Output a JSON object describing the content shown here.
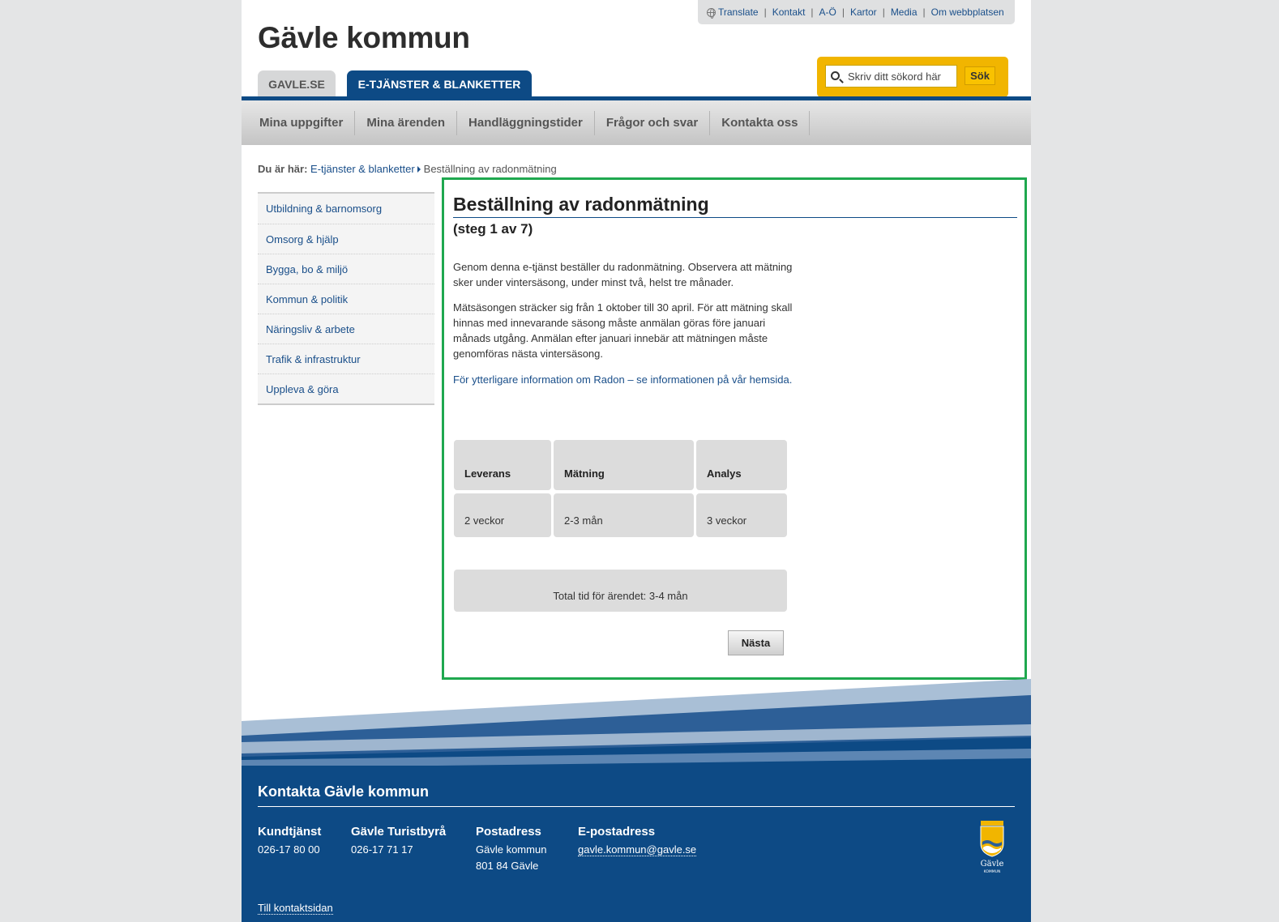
{
  "util": {
    "translate": "Translate",
    "kontakt": "Kontakt",
    "ao": "A-Ö",
    "kartor": "Kartor",
    "media": "Media",
    "om": "Om webbplatsen"
  },
  "logo": "Gävle kommun",
  "tabs": {
    "gavle": "GAVLE.SE",
    "etjanster": "E-TJÄNSTER & BLANKETTER"
  },
  "search": {
    "placeholder": "Skriv ditt sökord här",
    "button": "Sök"
  },
  "nav": [
    "Mina uppgifter",
    "Mina ärenden",
    "Handläggningstider",
    "Frågor och svar",
    "Kontakta oss"
  ],
  "breadcrumb": {
    "prefix": "Du är här:",
    "link": "E-tjänster & blanketter",
    "current": "Beställning av radonmätning"
  },
  "sidenav": [
    "Utbildning & barnomsorg",
    "Omsorg & hjälp",
    "Bygga, bo & miljö",
    "Kommun & politik",
    "Näringsliv & arbete",
    "Trafik & infrastruktur",
    "Uppleva & göra"
  ],
  "main": {
    "title": "Beställning av radonmätning",
    "step": "(steg 1 av 7)",
    "p1": "Genom denna e-tjänst beställer du radonmätning. Observera att mätning sker under vintersäsong, under minst två, helst tre månader.",
    "p2": "Mätsäsongen sträcker sig från 1 oktober till 30 april. För att mätning skall hinnas med innevarande säsong måste anmälan göras före januari månads utgång. Anmälan efter januari innebär att mätningen måste genomföras nästa vintersäsong.",
    "link": "För ytterligare information om Radon – se informationen på vår hemsida.",
    "table": {
      "headers": [
        "Leverans",
        "Mätning",
        "Analys"
      ],
      "values": [
        "2 veckor",
        "2-3 mån",
        "3 veckor"
      ]
    },
    "total": "Total tid för ärendet: 3-4 mån",
    "next": "Nästa"
  },
  "footer": {
    "title": "Kontakta Gävle kommun",
    "kundtjanst": {
      "label": "Kundtjänst",
      "phone": "026-17 80 00"
    },
    "turistbyra": {
      "label": "Gävle Turistbyrå",
      "phone": "026-17 71 17"
    },
    "postadress": {
      "label": "Postadress",
      "line1": "Gävle kommun",
      "line2": "801 84 Gävle"
    },
    "epost": {
      "label": "E-postadress",
      "email": "gavle.kommun@gavle.se"
    },
    "contact_link": "Till kontaktsidan",
    "crest_text": "Gävle",
    "crest_sub": "KOMMUN"
  }
}
